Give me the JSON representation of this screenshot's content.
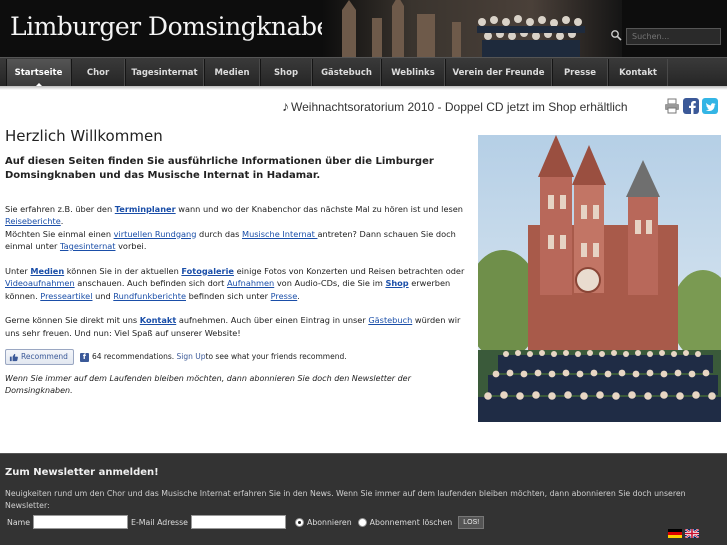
{
  "header": {
    "site_title": "Limburger Domsingknaben",
    "search_placeholder": "Suchen..."
  },
  "nav": {
    "items": [
      {
        "label": "Startseite",
        "active": true
      },
      {
        "label": "Chor"
      },
      {
        "label": "Tagesinternat"
      },
      {
        "label": "Medien"
      },
      {
        "label": "Shop"
      },
      {
        "label": "Gästebuch"
      },
      {
        "label": "Weblinks"
      },
      {
        "label": "Verein der Freunde"
      },
      {
        "label": "Presse"
      },
      {
        "label": "Kontakt"
      }
    ]
  },
  "ticker": {
    "text": "Weihnachtsoratorium 2010 - Doppel CD jetzt im Shop erhältlich",
    "icon": "music-note-icon"
  },
  "share_icons": [
    "print-icon",
    "facebook-icon",
    "twitter-icon"
  ],
  "main": {
    "heading": "Herzlich Willkommen",
    "intro": "Auf diesen Seiten finden Sie ausführliche Informationen über die Limburger Domsingknaben und das Musische Internat in Hadamar.",
    "p1": {
      "t1": "Sie erfahren z.B. über den ",
      "l1": "Terminplaner",
      "t2": " wann und wo der Knabenchor das nächste Mal zu hören ist und lesen ",
      "l2": "Reiseberichte",
      "t3": ".",
      "t4": "Möchten Sie einmal einen ",
      "l3": "virtuellen Rundgang",
      "t5": " durch das ",
      "l4": "Musische Internat ",
      "t6": "antreten? Dann schauen Sie doch einmal unter ",
      "l5": "Tagesinternat",
      "t7": " vorbei."
    },
    "p2": {
      "t1": "Unter ",
      "l1": "Medien",
      "t2": " können Sie in der aktuellen ",
      "l2": "Fotogalerie",
      "t3": " einige Fotos von Konzerten und Reisen betrachten oder ",
      "l3": "Videoaufnahmen",
      "t4": " anschauen. Auch befinden sich dort ",
      "l4": "Aufnahmen",
      "t5": " von Audio-CDs, die Sie im ",
      "l5": "Shop",
      "t6": " erwerben können. ",
      "l6": "Presseartikel",
      "t7": " und ",
      "l7": "Rundfunkberichte",
      "t8": " befinden sich unter ",
      "l8": "Presse",
      "t9": "."
    },
    "p3": {
      "t1": "Gerne können Sie direkt mit uns ",
      "l1": "Kontakt",
      "t2": " aufnehmen. Auch über einen Eintrag in unser ",
      "l2": "Gästebuch",
      "t3": " würden wir uns sehr freuen. Und nun: Viel Spaß auf unserer Website!"
    },
    "fb": {
      "button": "Recommend",
      "count_text": "64 recommendations.",
      "signup": "Sign Up",
      "rest": " to see what your friends recommend."
    },
    "newsletter_note": "Wenn Sie immer auf dem Laufenden bleiben möchten, dann abonnieren Sie doch den Newsletter der Domsingknaben."
  },
  "footer": {
    "heading": "Zum Newsletter anmelden!",
    "desc": "Neuigkeiten rund um den Chor und das Musische Internat erfahren Sie in den News. Wenn Sie immer auf dem laufenden bleiben möchten, dann abonnieren Sie doch unseren Newsletter:",
    "name_label": "Name",
    "email_label": "E-Mail Adresse",
    "subscribe_label": "Abonnieren",
    "unsubscribe_label": "Abonnement löschen",
    "submit_label": "LOS!"
  },
  "flags": [
    "german-flag-icon",
    "english-flag-icon"
  ]
}
